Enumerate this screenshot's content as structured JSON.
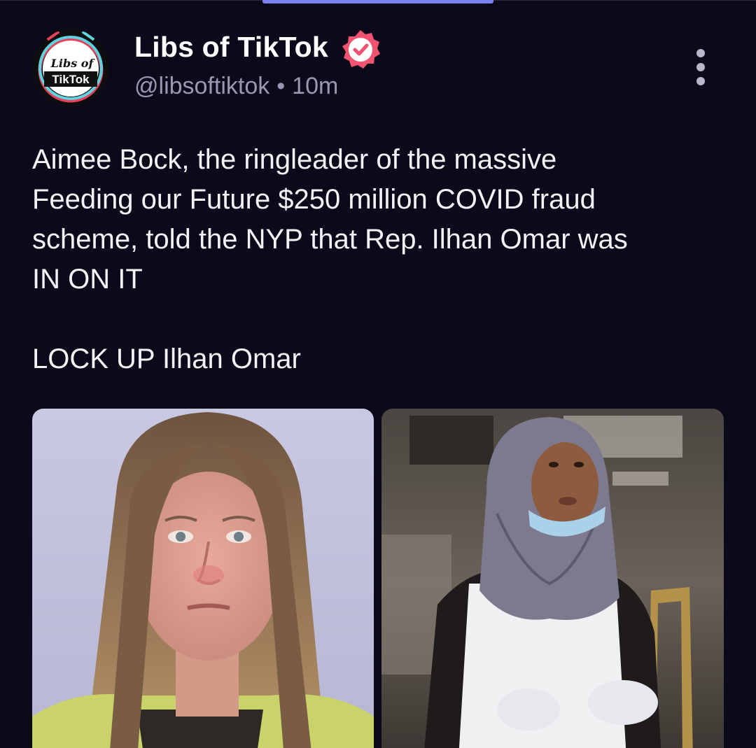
{
  "header": {
    "display_name": "Libs of TikTok",
    "handle": "@libsoftiktok",
    "separator": "•",
    "time": "10m",
    "avatar_text_line1": "Libs of",
    "avatar_text_line2": "TikTok",
    "verified_icon": "verified-check-icon",
    "verified_color": "#f0536f",
    "more_icon": "vertical-ellipsis-icon"
  },
  "post": {
    "line1": "Aimee Bock, the ringleader of the massive",
    "line2": "Feeding our Future $250 million COVID fraud",
    "line3": "scheme, told the NYP that Rep. Ilhan Omar was",
    "line4": "IN ON IT",
    "line5": "LOCK UP Ilhan Omar"
  },
  "colors": {
    "background": "#0c0a1a",
    "tab_indicator": "#7b7ff0",
    "text": "#f3f3f7",
    "muted": "#9a97b0"
  }
}
